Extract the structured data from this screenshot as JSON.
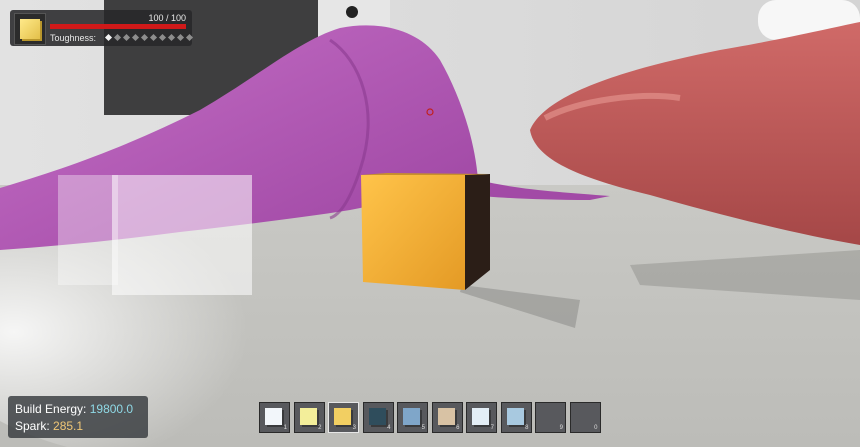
{
  "hud": {
    "health_text": "100 / 100",
    "health_fraction": 1.0,
    "toughness_label": "Toughness:",
    "toughness_filled": 1,
    "toughness_total": 10,
    "selected_block_icon": "yellow-cube-icon"
  },
  "stats": {
    "build_energy_label": "Build Energy:",
    "build_energy_value": "19800.0",
    "spark_label": "Spark:",
    "spark_value": "285.1"
  },
  "hotbar": {
    "selected_index": 2,
    "slots": [
      {
        "number": "1",
        "icon": "white-ice-cube-icon",
        "color": "#f2f6fa"
      },
      {
        "number": "2",
        "icon": "pale-yellow-cube-icon",
        "color": "#f3ee9a"
      },
      {
        "number": "3",
        "icon": "yellow-cube-icon",
        "color": "#f2cf62"
      },
      {
        "number": "4",
        "icon": "dark-teal-cube-icon",
        "color": "#2f4d5c"
      },
      {
        "number": "5",
        "icon": "blue-stone-cube-icon",
        "color": "#7fa6c9"
      },
      {
        "number": "6",
        "icon": "beige-cube-icon",
        "color": "#d8c2a4"
      },
      {
        "number": "7",
        "icon": "frost-cube-icon",
        "color": "#e3eef6"
      },
      {
        "number": "8",
        "icon": "ice-blue-cube-icon",
        "color": "#a8c9e0"
      },
      {
        "number": "9",
        "icon": "",
        "color": ""
      },
      {
        "number": "0",
        "icon": "",
        "color": ""
      }
    ]
  },
  "colors": {
    "health": "#d01919",
    "energy_value": "#8fd9e6",
    "spark_value": "#f0c776",
    "cloth": "#b359b8",
    "blob": "#c85a5a",
    "cube": "#f0b23a"
  }
}
